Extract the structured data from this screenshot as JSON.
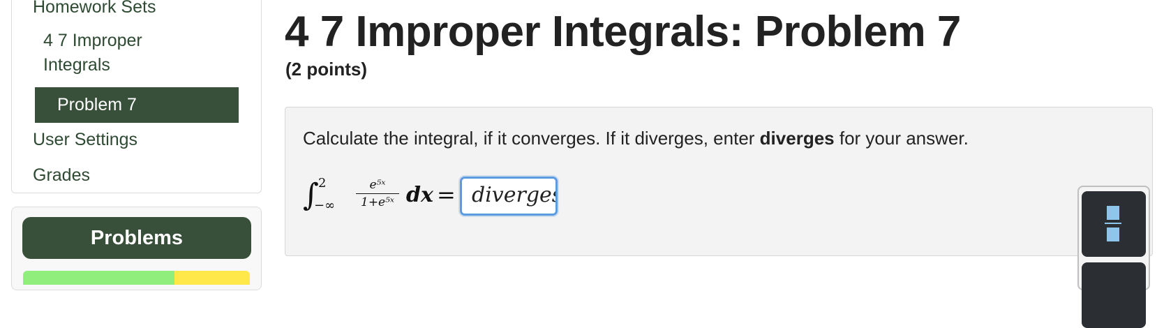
{
  "sidebar": {
    "homework_sets": "Homework Sets",
    "set_name_line1": "4 7 Improper",
    "set_name_line2": "Integrals",
    "active_problem": "Problem 7",
    "user_settings": "User Settings",
    "grades": "Grades",
    "problems_button": "Problems"
  },
  "problem": {
    "title": "4 7 Improper Integrals: Problem 7",
    "points": "(2 points)",
    "instructions_before": "Calculate the integral, if it converges. If it diverges, enter ",
    "instructions_bold": "diverges",
    "instructions_after": " for your answer.",
    "integral": {
      "upper_limit": "2",
      "lower_limit": "−∞",
      "numerator": "e⁵ˣ",
      "denominator": "1+e⁵ˣ",
      "differential": "dx",
      "equals": "="
    },
    "answer_value": "diverges"
  },
  "colors": {
    "nav_active_bg": "#384f39",
    "input_focus_border": "#5b9be0",
    "progress_green": "#90ee7c",
    "progress_yellow": "#ffe94a",
    "toolbar_button_bg": "#2b2f33",
    "toolbar_icon": "#8ec5ea"
  },
  "icons": {
    "toolbar_first": "fraction-icon"
  }
}
